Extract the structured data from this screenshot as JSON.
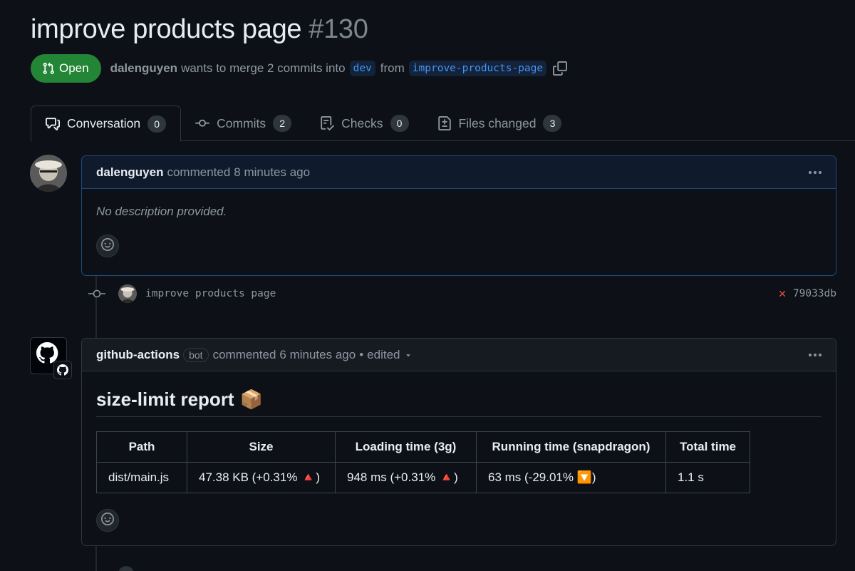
{
  "pr": {
    "title": "improve products page",
    "number": "#130",
    "state": "Open",
    "author": "dalenguyen",
    "merge_text": "wants to merge 2 commits into",
    "base_branch": "dev",
    "from_text": "from",
    "head_branch": "improve-products-page"
  },
  "tabs": [
    {
      "label": "Conversation",
      "count": "0",
      "icon": "conversation-icon"
    },
    {
      "label": "Commits",
      "count": "2",
      "icon": "commit-icon"
    },
    {
      "label": "Checks",
      "count": "0",
      "icon": "checklist-icon"
    },
    {
      "label": "Files changed",
      "count": "3",
      "icon": "file-diff-icon"
    }
  ],
  "comment1": {
    "author": "dalenguyen",
    "action": "commented",
    "time": "8 minutes ago",
    "body": "No description provided."
  },
  "commit": {
    "message": "improve products page",
    "sha": "79033db",
    "status": "failed"
  },
  "comment2": {
    "author": "github-actions",
    "badge": "bot",
    "action": "commented",
    "time": "6 minutes ago",
    "separator": "•",
    "edited": "edited",
    "report_title": "size-limit report",
    "report_emoji": "📦",
    "table": {
      "headers": [
        "Path",
        "Size",
        "Loading time (3g)",
        "Running time (snapdragon)",
        "Total time"
      ],
      "rows": [
        [
          "dist/main.js",
          "47.38 KB (+0.31% 🔺)",
          "948 ms (+0.31% 🔺)",
          "63 ms (-29.01% 🔽)",
          "1.1 s"
        ]
      ]
    }
  },
  "colors": {
    "background": "#0d1117",
    "open_green": "#238636",
    "link_blue": "#4493f8",
    "fail_red": "#f85149"
  }
}
